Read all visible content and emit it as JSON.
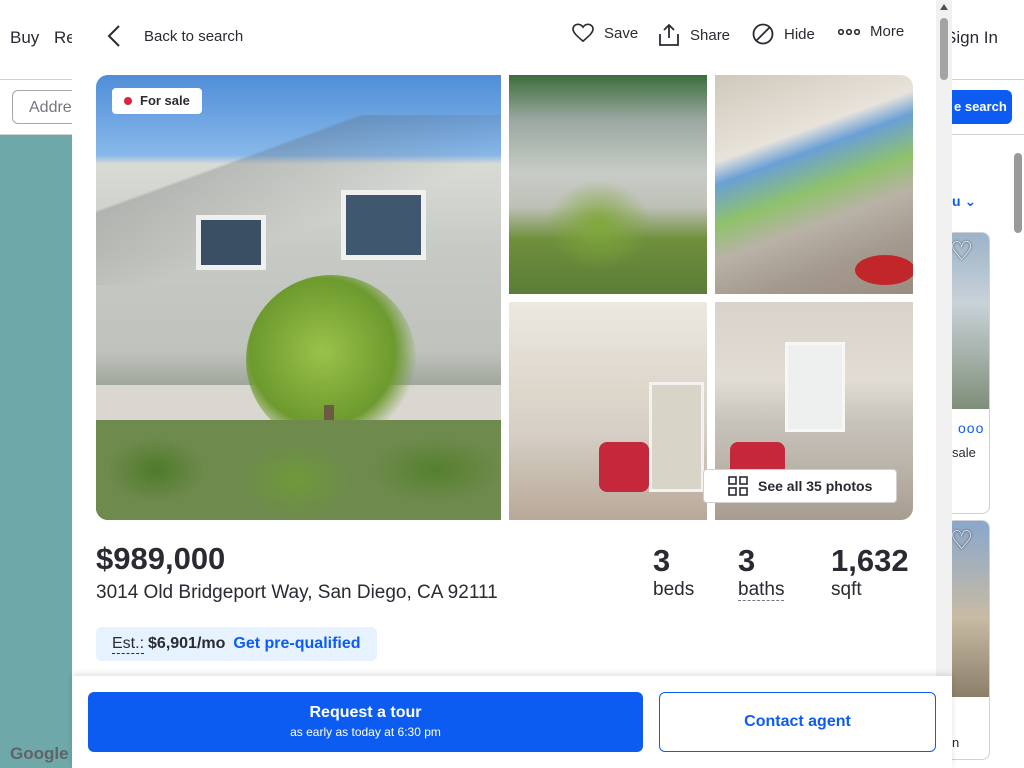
{
  "background": {
    "nav": {
      "buy": "Buy",
      "rent": "Re",
      "sign_in": "Sign In"
    },
    "search_placeholder": "Addre",
    "save_search": "e search",
    "sort_label": "u",
    "card1_text": "sale",
    "card2_text": "n",
    "map_logo": "Google",
    "colors": {
      "map": "#6fa8a8",
      "accent": "#0d5cf2"
    }
  },
  "modal": {
    "back_label": "Back to search",
    "actions": {
      "save": "Save",
      "share": "Share",
      "hide": "Hide",
      "more": "More"
    },
    "status_badge": "For sale",
    "see_all_photos": "See all 35 photos",
    "price": "$989,000",
    "address": "3014 Old Bridgeport Way, San Diego, CA 92111",
    "stats": {
      "beds": {
        "value": "3",
        "label": "beds"
      },
      "baths": {
        "value": "3",
        "label": "baths"
      },
      "sqft": {
        "value": "1,632",
        "label": "sqft"
      }
    },
    "estimate": {
      "label": "Est.:",
      "value": "$6,901/mo",
      "cta": "Get pre-qualified"
    },
    "buttons": {
      "tour_title": "Request a tour",
      "tour_subtitle": "as early as today at 6:30 pm",
      "contact": "Contact agent"
    }
  }
}
